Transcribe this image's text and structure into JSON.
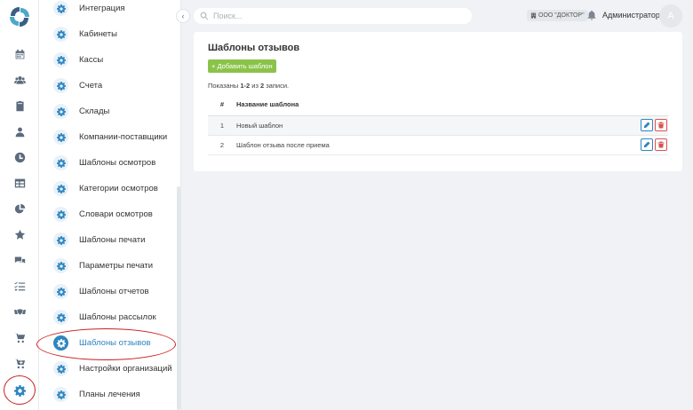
{
  "rail": {
    "items": [
      {
        "icon": "calendar-icon"
      },
      {
        "icon": "users-icon"
      },
      {
        "icon": "clipboard-icon"
      },
      {
        "icon": "patient-icon"
      },
      {
        "icon": "clock-icon"
      },
      {
        "icon": "table-icon"
      },
      {
        "icon": "pie-chart-icon"
      },
      {
        "icon": "star-icon"
      },
      {
        "icon": "comments-icon"
      },
      {
        "icon": "checklist-icon"
      },
      {
        "icon": "handshake-icon"
      },
      {
        "icon": "cart-icon"
      },
      {
        "icon": "cart-add-icon"
      },
      {
        "icon": "settings-gear-icon",
        "active": true
      }
    ]
  },
  "submenu": {
    "items": [
      {
        "label": "Интеграция"
      },
      {
        "label": "Кабинеты"
      },
      {
        "label": "Кассы"
      },
      {
        "label": "Счета"
      },
      {
        "label": "Склады"
      },
      {
        "label": "Компании-поставщики"
      },
      {
        "label": "Шаблоны осмотров"
      },
      {
        "label": "Категории осмотров"
      },
      {
        "label": "Словари осмотров"
      },
      {
        "label": "Шаблоны печати"
      },
      {
        "label": "Параметры печати"
      },
      {
        "label": "Шаблоны отчетов"
      },
      {
        "label": "Шаблоны рассылок"
      },
      {
        "label": "Шаблоны отзывов",
        "active": true
      },
      {
        "label": "Настройки организаций"
      },
      {
        "label": "Планы лечения"
      }
    ]
  },
  "topbar": {
    "collapse_icon": "‹",
    "search_placeholder": "Поиск...",
    "org_badge": "ООО \"ДОКТОР\"",
    "user_name": "Администратор",
    "avatar_letter": "A"
  },
  "main": {
    "title": "Шаблоны отзывов",
    "add_button": "+ Добавить шаблон",
    "summary_prefix": "Показаны ",
    "summary_range": "1-2",
    "summary_mid": " из ",
    "summary_total": "2",
    "summary_suffix": " записи.",
    "table": {
      "headers": [
        "#",
        "Название шаблона"
      ],
      "rows": [
        {
          "num": "1",
          "name": "Новый шаблон"
        },
        {
          "num": "2",
          "name": "Шаблон отзыва после приема"
        }
      ]
    }
  },
  "colors": {
    "accent": "#2e86c1",
    "add_button": "#8bc34a",
    "delete": "#d9534f",
    "highlight_circle": "#c9201f"
  }
}
